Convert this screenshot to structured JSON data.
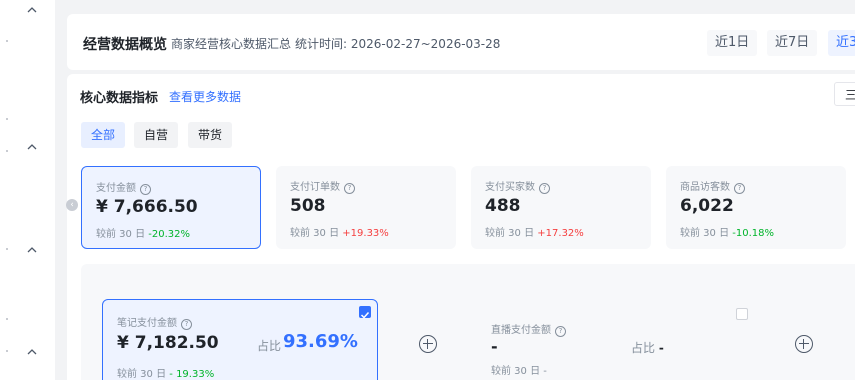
{
  "header": {
    "title": "经营数据概览",
    "subtitle": "商家经营核心数据汇总",
    "stat_time_label": "统计时间:",
    "stat_time_value": "2026-02-27~2026-03-28",
    "ranges": [
      {
        "label": "近1日"
      },
      {
        "label": "近7日"
      },
      {
        "label": "近3"
      }
    ]
  },
  "core": {
    "title": "核心数据指标",
    "more_link": "查看更多数据",
    "right_button_partial": "三"
  },
  "segments": [
    {
      "label": "全部",
      "active": true
    },
    {
      "label": "自营",
      "active": false
    },
    {
      "label": "带货",
      "active": false
    }
  ],
  "metrics": [
    {
      "label": "支付金额",
      "value": "¥ 7,666.50",
      "compare_prefix": "较前 30 日",
      "change": "-20.32%",
      "direction": "down"
    },
    {
      "label": "支付订单数",
      "value": "508",
      "compare_prefix": "较前 30 日",
      "change": "+19.33%",
      "direction": "up"
    },
    {
      "label": "支付买家数",
      "value": "488",
      "compare_prefix": "较前 30 日",
      "change": "+17.32%",
      "direction": "up"
    },
    {
      "label": "商品访客数",
      "value": "6,022",
      "compare_prefix": "较前 30 日",
      "change": "-10.18%",
      "direction": "down"
    }
  ],
  "breakdown": {
    "note_pay": {
      "label": "笔记支付金额",
      "value": "¥ 7,182.50",
      "share_label": "占比",
      "share_value": "93.69%",
      "compare_prefix": "较前 30 日",
      "change": "- 19.33%"
    },
    "live_pay": {
      "label": "直播支付金额",
      "value": "-",
      "share_label": "占比",
      "share_value": "-",
      "compare_prefix": "较前 30 日",
      "change": "-"
    }
  },
  "colors": {
    "accent": "#3370ff",
    "down": "#00b42a",
    "up": "#f53f3f"
  },
  "icons": {
    "help": "question-circle-icon",
    "add": "plus-circle-icon",
    "collapse": "chevron-up-icon",
    "scroll": "chevron-left-icon",
    "check": "checkbox-checked-icon"
  }
}
